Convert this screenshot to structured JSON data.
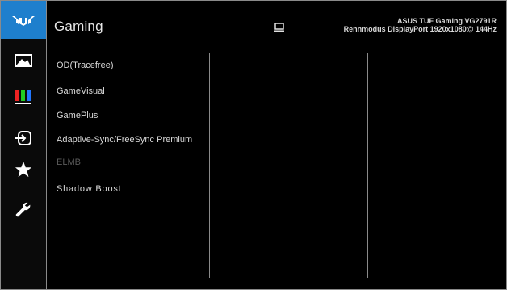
{
  "header": {
    "title": "Gaming",
    "model": "ASUS TUF Gaming  VG2791R",
    "status": "Rennmodus  DisplayPort  1920x1080@ 144Hz"
  },
  "sidebar": {
    "items": [
      {
        "icon": "tuf-logo"
      },
      {
        "icon": "image-icon"
      },
      {
        "icon": "color-bars-icon"
      },
      {
        "icon": "input-select-icon"
      },
      {
        "icon": "star-icon"
      },
      {
        "icon": "wrench-icon"
      }
    ]
  },
  "menu": {
    "items": [
      {
        "label": "OD(Tracefree)",
        "enabled": true
      },
      {
        "label": "GameVisual",
        "enabled": true
      },
      {
        "label": "GamePlus",
        "enabled": true
      },
      {
        "label": "Adaptive-Sync/FreeSync Premium",
        "enabled": true
      },
      {
        "label": "ELMB",
        "enabled": false
      },
      {
        "label": "Shadow Boost",
        "enabled": true
      }
    ]
  },
  "colors": {
    "accent": "#1e7fcd",
    "background": "#000000",
    "text": "#d9d9d9",
    "disabled_text": "#5c5c5c",
    "border": "#8a8a8a"
  }
}
